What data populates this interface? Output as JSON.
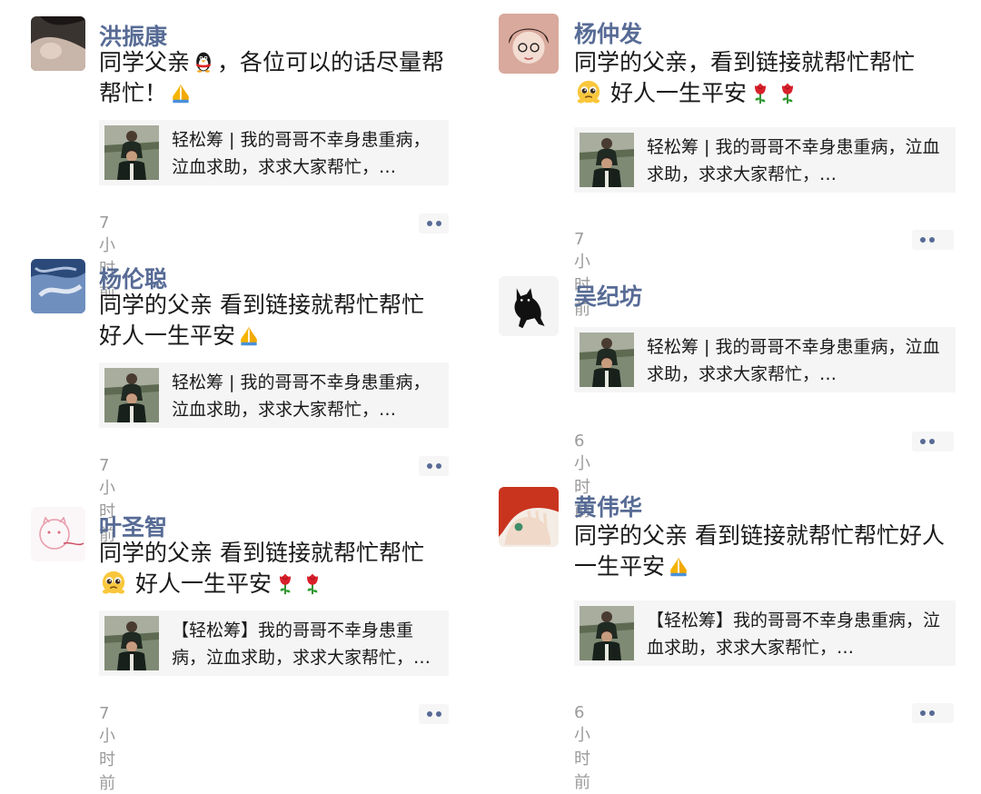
{
  "posts": [
    {
      "name": "洪振康",
      "text_parts": [
        "同学父亲",
        "，各位可以的话尽量帮帮忙！"
      ],
      "emoji_names": [
        "penguin-emoji",
        "pray-emoji"
      ],
      "link_title": "轻松筹 | 我的哥哥不幸身患重病，泣血求助，求求大家帮忙，…",
      "time": "7小时前"
    },
    {
      "name": "杨伦聪",
      "text_parts": [
        "同学的父亲 看到链接就帮忙帮忙好人一生平安"
      ],
      "emoji_names": [
        "pray-emoji"
      ],
      "link_title": "轻松筹 | 我的哥哥不幸身患重病，泣血求助，求求大家帮忙，…",
      "time": "7小时前"
    },
    {
      "name": "叶圣智",
      "text_parts": [
        "同学的父亲 看到链接就帮忙帮忙",
        " 好人一生平安"
      ],
      "emoji_names": [
        "pleading-emoji",
        "rose-emoji",
        "rose-emoji"
      ],
      "link_title": "【轻松筹】我的哥哥不幸身患重病，泣血求助，求求大家帮忙，…",
      "time": "7小时前"
    },
    {
      "name": "杨仲发",
      "text_parts": [
        "同学的父亲，看到链接就帮忙帮忙",
        " 好人一生平安"
      ],
      "emoji_names": [
        "pleading-emoji",
        "rose-emoji",
        "rose-emoji"
      ],
      "link_title": "轻松筹 | 我的哥哥不幸身患重病，泣血求助，求求大家帮忙，…",
      "time": "7小时前"
    },
    {
      "name": "吴纪坊",
      "text_parts": [],
      "emoji_names": [],
      "link_title": "轻松筹 | 我的哥哥不幸身患重病，泣血求助，求求大家帮忙，…",
      "time": "6小时前"
    },
    {
      "name": "黄伟华",
      "text_parts": [
        "同学的父亲 看到链接就帮忙帮忙好人一生平安"
      ],
      "emoji_names": [
        "pray-emoji"
      ],
      "link_title": "【轻松筹】我的哥哥不幸身患重病，泣血求助，求求大家帮忙，…",
      "time": "6小时前"
    }
  ],
  "colors": {
    "name": "#576b95",
    "time": "#9b9b9b",
    "link_bg": "#f5f5f5"
  },
  "icons": {
    "more": "more-dots-icon"
  }
}
